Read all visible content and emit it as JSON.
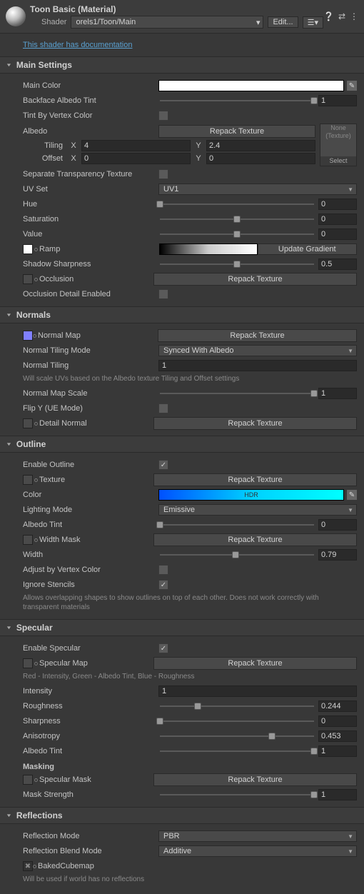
{
  "header": {
    "title": "Toon Basic (Material)",
    "shader_label": "Shader",
    "shader_value": "orels1/Toon/Main",
    "edit_label": "Edit..."
  },
  "doc_link": "This shader has documentation",
  "sections": {
    "main": {
      "title": "Main Settings",
      "main_color": "Main Color",
      "backface_tint": "Backface Albedo Tint",
      "backface_val": "1",
      "tint_vertex": "Tint By Vertex Color",
      "albedo": "Albedo",
      "repack": "Repack Texture",
      "tex_none": "None (Texture)",
      "tex_select": "Select",
      "tiling": "Tiling",
      "tiling_x": "4",
      "tiling_y": "2.4",
      "offset": "Offset",
      "offset_x": "0",
      "offset_y": "0",
      "sep_trans": "Separate Transparency Texture",
      "uv_set": "UV Set",
      "uv_set_val": "UV1",
      "hue": "Hue",
      "hue_val": "0",
      "sat": "Saturation",
      "sat_val": "0",
      "value": "Value",
      "value_val": "0",
      "ramp": "Ramp",
      "update_gradient": "Update Gradient",
      "shadow_sharp": "Shadow Sharpness",
      "shadow_val": "0.5",
      "occlusion": "Occlusion",
      "occ_detail": "Occlusion Detail Enabled"
    },
    "normals": {
      "title": "Normals",
      "normal_map": "Normal Map",
      "repack": "Repack Texture",
      "tiling_mode": "Normal Tiling Mode",
      "tiling_mode_val": "Synced With Albedo",
      "normal_tiling": "Normal Tiling",
      "normal_tiling_val": "1",
      "help": "Will scale UVs based on the Albedo texture Tiling and Offset settings",
      "scale": "Normal Map Scale",
      "scale_val": "1",
      "flipy": "Flip Y (UE Mode)",
      "detail": "Detail Normal"
    },
    "outline": {
      "title": "Outline",
      "enable": "Enable Outline",
      "texture": "Texture",
      "repack": "Repack Texture",
      "color": "Color",
      "hdr": "HDR",
      "lighting_mode": "Lighting Mode",
      "lighting_val": "Emissive",
      "albedo_tint": "Albedo Tint",
      "albedo_tint_val": "0",
      "width_mask": "Width Mask",
      "width": "Width",
      "width_val": "0.79",
      "adjust_vc": "Adjust by Vertex Color",
      "ignore_stencils": "Ignore Stencils",
      "help": "Allows overlapping shapes to show outlines on top of each other. Does not work correctly with transparent materials"
    },
    "specular": {
      "title": "Specular",
      "enable": "Enable Specular",
      "spec_map": "Specular Map",
      "repack": "Repack Texture",
      "help1": "Red - Intensity, Green - Albedo Tint, Blue - Roughness",
      "intensity": "Intensity",
      "intensity_val": "1",
      "roughness": "Roughness",
      "roughness_val": "0.244",
      "sharpness": "Sharpness",
      "sharpness_val": "0",
      "anisotropy": "Anisotropy",
      "anisotropy_val": "0.453",
      "albedo_tint": "Albedo Tint",
      "albedo_tint_val": "1",
      "masking": "Masking",
      "spec_mask": "Specular Mask",
      "mask_strength": "Mask Strength",
      "mask_strength_val": "1"
    },
    "reflections": {
      "title": "Reflections",
      "mode": "Reflection Mode",
      "mode_val": "PBR",
      "blend_mode": "Reflection Blend Mode",
      "blend_val": "Additive",
      "cubemap": "BakedCubemap",
      "help": "Will be used if world has no reflections"
    }
  },
  "chart_data": {
    "type": "table",
    "title": "Slider values",
    "rows": [
      {
        "property": "Backface Albedo Tint",
        "value": 1,
        "min": 0,
        "max": 1
      },
      {
        "property": "Hue",
        "value": 0,
        "min": -1,
        "max": 1
      },
      {
        "property": "Saturation",
        "value": 0,
        "min": -1,
        "max": 1
      },
      {
        "property": "Value",
        "value": 0,
        "min": -1,
        "max": 1
      },
      {
        "property": "Shadow Sharpness",
        "value": 0.5,
        "min": 0,
        "max": 1
      },
      {
        "property": "Normal Map Scale",
        "value": 1,
        "min": 0,
        "max": 1
      },
      {
        "property": "Outline Albedo Tint",
        "value": 0,
        "min": 0,
        "max": 1
      },
      {
        "property": "Width",
        "value": 0.79,
        "min": 0,
        "max": 1.6
      },
      {
        "property": "Roughness",
        "value": 0.244,
        "min": 0,
        "max": 1
      },
      {
        "property": "Sharpness",
        "value": 0,
        "min": 0,
        "max": 1
      },
      {
        "property": "Anisotropy",
        "value": 0.453,
        "min": -1,
        "max": 1
      },
      {
        "property": "Specular Albedo Tint",
        "value": 1,
        "min": 0,
        "max": 1
      },
      {
        "property": "Mask Strength",
        "value": 1,
        "min": 0,
        "max": 1
      }
    ]
  }
}
